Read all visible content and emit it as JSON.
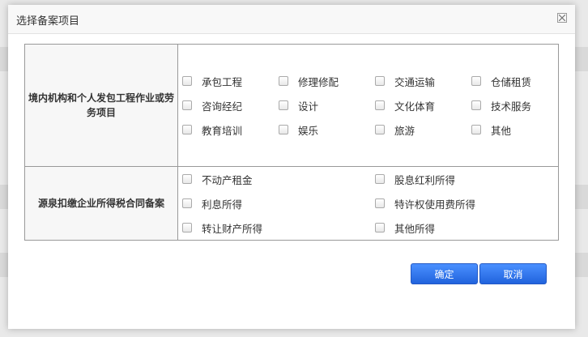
{
  "dialog": {
    "title": "选择备案项目",
    "ok_label": "确定",
    "cancel_label": "取消",
    "close_icon": "close-icon"
  },
  "sections": [
    {
      "category": "境内机构和个人发包工程作业或劳务项目",
      "options": [
        "承包工程",
        "修理修配",
        "交通运输",
        "仓储租赁",
        "咨询经纪",
        "设计",
        "文化体育",
        "技术服务",
        "教育培训",
        "娱乐",
        "旅游",
        "其他"
      ]
    },
    {
      "category": "源泉扣缴企业所得税合同备案",
      "options": [
        "不动产租金",
        "股息红利所得",
        "利息所得",
        "特许权使用费所得",
        "转让财产所得",
        "其他所得"
      ]
    }
  ],
  "colors": {
    "primary_button": "#2f74ee",
    "border": "#999999",
    "category_bg": "#f7f7f7"
  }
}
